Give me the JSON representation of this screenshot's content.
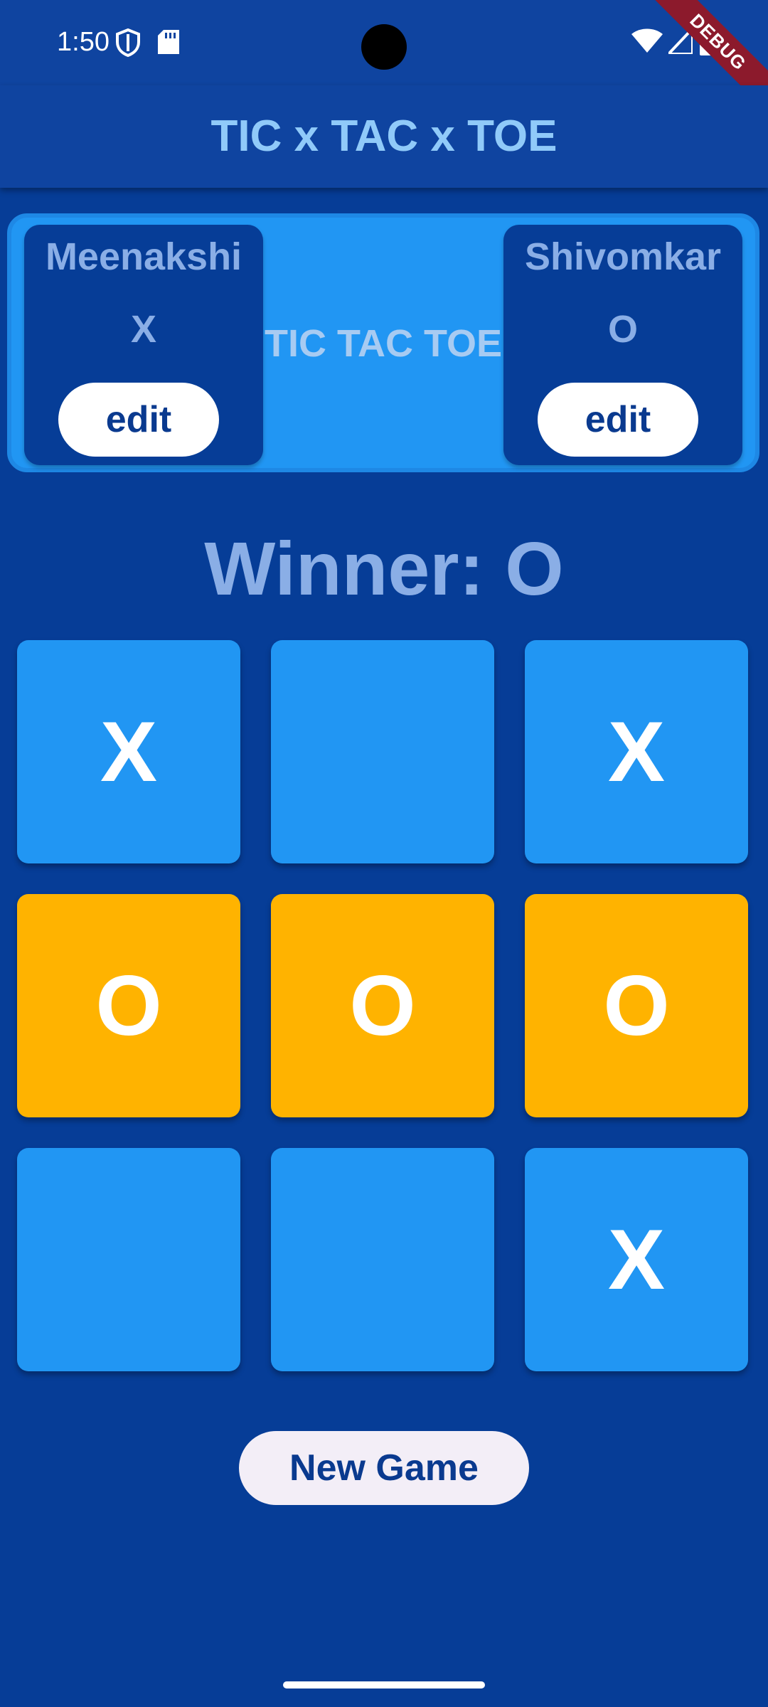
{
  "status_bar": {
    "time": "1:50",
    "icons": [
      "shield-icon",
      "sd-card-icon",
      "wifi-icon",
      "signal-icon",
      "battery-icon"
    ],
    "debug_banner": "DEBUG"
  },
  "app_bar": {
    "title": "TIC x TAC x TOE"
  },
  "players": {
    "left": {
      "name": "Meenakshi",
      "symbol": "X",
      "edit_label": "edit"
    },
    "right": {
      "name": "Shivomkar",
      "symbol": "O",
      "edit_label": "edit"
    },
    "center_label": "TIC TAC TOE"
  },
  "game": {
    "winner_text": "Winner: O",
    "board": [
      "X",
      "",
      "X",
      "O",
      "O",
      "O",
      "",
      "",
      "X"
    ],
    "winning_cells": [
      3,
      4,
      5
    ],
    "new_game_label": "New Game"
  },
  "colors": {
    "background": "#063d97",
    "app_bar": "#0f44a0",
    "cell": "#2196f3",
    "winning_cell": "#ffb300",
    "title_text": "#90caf9"
  }
}
